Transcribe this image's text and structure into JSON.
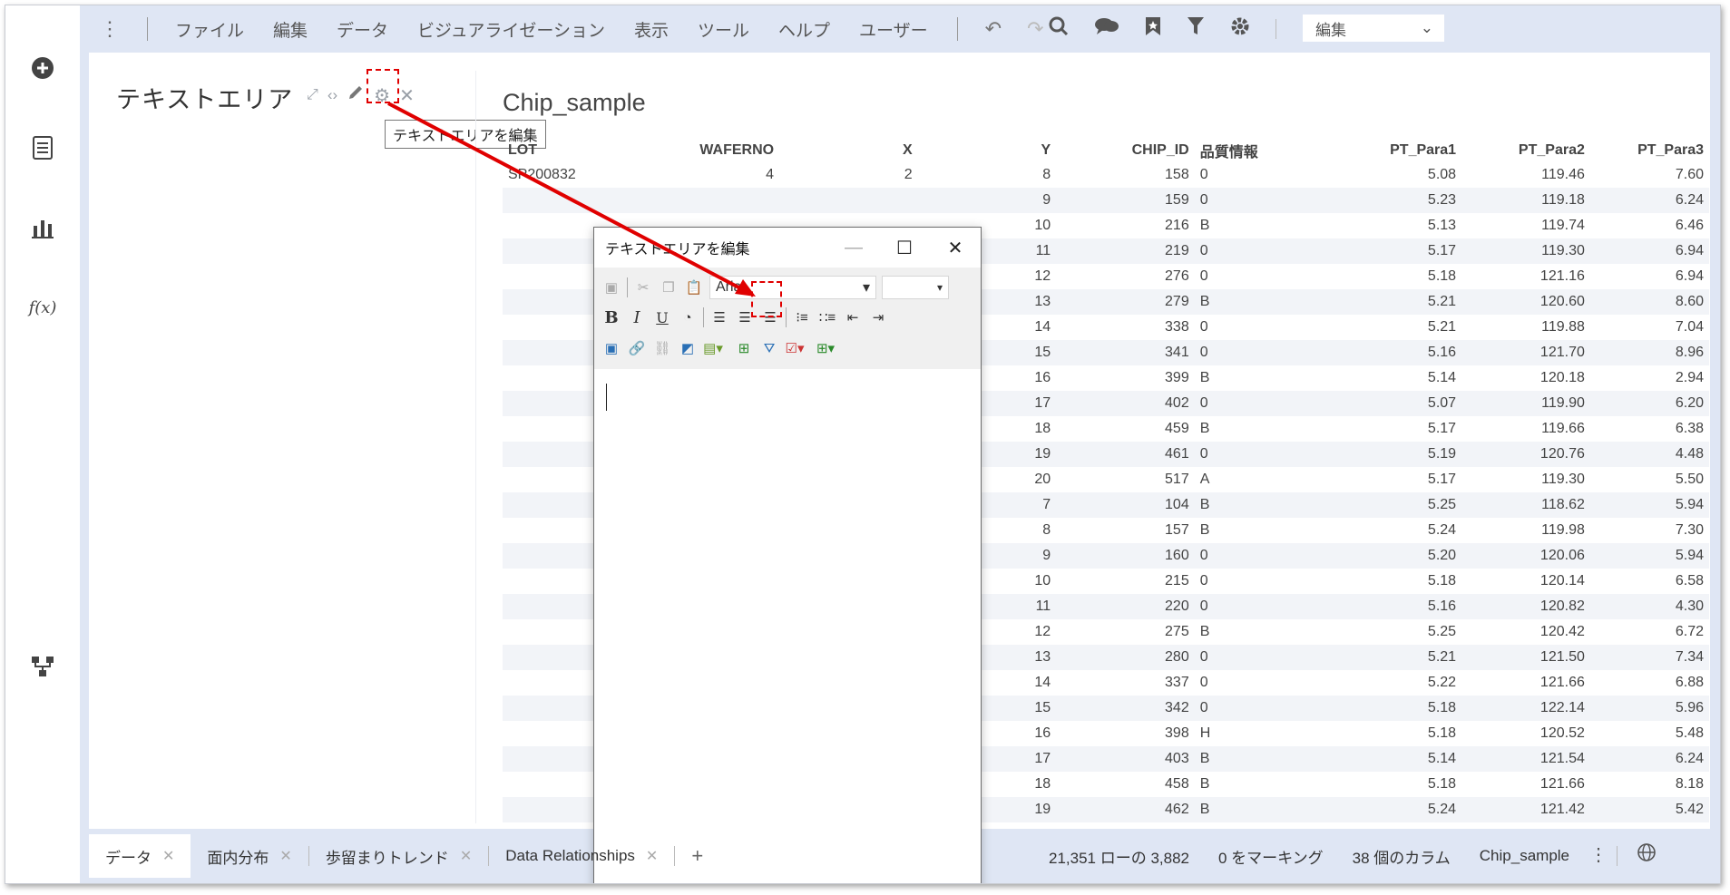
{
  "menu": [
    "ファイル",
    "編集",
    "データ",
    "ビジュアライゼーション",
    "表示",
    "ツール",
    "ヘルプ",
    "ユーザー"
  ],
  "mode_select": "編集",
  "left_rail": [
    "add-icon",
    "data-canvas-icon",
    "visualizations-icon",
    "fx-icon",
    "structure-icon"
  ],
  "text_area": {
    "title": "テキストエリア",
    "tooltip": "テキストエリアを編集"
  },
  "table": {
    "title": "Chip_sample",
    "columns": [
      "LOT",
      "WAFERNO",
      "X",
      "Y",
      "CHIP_ID",
      "品質情報",
      "PT_Para1",
      "PT_Para2",
      "PT_Para3"
    ],
    "rows": [
      [
        "SP200832",
        "4",
        "2",
        "8",
        "158",
        "0",
        "5.08",
        "119.46",
        "7.60"
      ],
      [
        "",
        "",
        "",
        "9",
        "159",
        "0",
        "5.23",
        "119.18",
        "6.24"
      ],
      [
        "",
        "",
        "",
        "10",
        "216",
        "B",
        "5.13",
        "119.74",
        "6.46"
      ],
      [
        "",
        "",
        "",
        "11",
        "219",
        "0",
        "5.17",
        "119.30",
        "6.94"
      ],
      [
        "",
        "",
        "",
        "12",
        "276",
        "0",
        "5.18",
        "121.16",
        "6.94"
      ],
      [
        "",
        "",
        "",
        "13",
        "279",
        "B",
        "5.21",
        "120.60",
        "8.60"
      ],
      [
        "",
        "",
        "",
        "14",
        "338",
        "0",
        "5.21",
        "119.88",
        "7.04"
      ],
      [
        "",
        "",
        "",
        "15",
        "341",
        "0",
        "5.16",
        "121.70",
        "8.96"
      ],
      [
        "",
        "",
        "",
        "16",
        "399",
        "B",
        "5.14",
        "120.18",
        "2.94"
      ],
      [
        "",
        "",
        "",
        "17",
        "402",
        "0",
        "5.07",
        "119.90",
        "6.20"
      ],
      [
        "",
        "",
        "",
        "18",
        "459",
        "B",
        "5.17",
        "119.66",
        "6.38"
      ],
      [
        "",
        "",
        "",
        "19",
        "461",
        "0",
        "5.19",
        "120.76",
        "4.48"
      ],
      [
        "",
        "",
        "",
        "20",
        "517",
        "A",
        "5.17",
        "119.30",
        "5.50"
      ],
      [
        "",
        "",
        "",
        "7",
        "104",
        "B",
        "5.25",
        "118.62",
        "5.94"
      ],
      [
        "",
        "",
        "",
        "8",
        "157",
        "B",
        "5.24",
        "119.98",
        "7.30"
      ],
      [
        "",
        "",
        "",
        "9",
        "160",
        "0",
        "5.20",
        "120.06",
        "5.94"
      ],
      [
        "",
        "",
        "",
        "10",
        "215",
        "0",
        "5.18",
        "120.14",
        "6.58"
      ],
      [
        "",
        "",
        "",
        "11",
        "220",
        "0",
        "5.16",
        "120.82",
        "4.30"
      ],
      [
        "",
        "",
        "",
        "12",
        "275",
        "B",
        "5.25",
        "120.42",
        "6.72"
      ],
      [
        "",
        "",
        "",
        "13",
        "280",
        "0",
        "5.21",
        "121.50",
        "7.34"
      ],
      [
        "",
        "",
        "",
        "14",
        "337",
        "0",
        "5.22",
        "121.66",
        "6.88"
      ],
      [
        "",
        "",
        "",
        "15",
        "342",
        "0",
        "5.18",
        "122.14",
        "5.96"
      ],
      [
        "",
        "",
        "",
        "16",
        "398",
        "H",
        "5.18",
        "120.52",
        "5.48"
      ],
      [
        "",
        "",
        "",
        "17",
        "403",
        "B",
        "5.14",
        "121.54",
        "6.24"
      ],
      [
        "",
        "",
        "",
        "18",
        "458",
        "B",
        "5.18",
        "121.66",
        "8.18"
      ],
      [
        "",
        "",
        "",
        "19",
        "462",
        "B",
        "5.24",
        "121.42",
        "5.42"
      ]
    ]
  },
  "dialog": {
    "title": "テキストエリアを編集",
    "font": "Arial",
    "bold": "B",
    "italic": "I",
    "underline": "U"
  },
  "bottom": {
    "tabs": [
      "データ",
      "面内分布",
      "歩留まりトレンド",
      "Data Relationships"
    ],
    "add_tab": "+",
    "rows_status": "21,351 ローの 3,882",
    "marking_status": "0 をマーキング",
    "columns_status": "38 個のカラム",
    "table_name": "Chip_sample"
  },
  "colors": {
    "annotation": "#e00000",
    "chrome": "#dfe6f4"
  }
}
